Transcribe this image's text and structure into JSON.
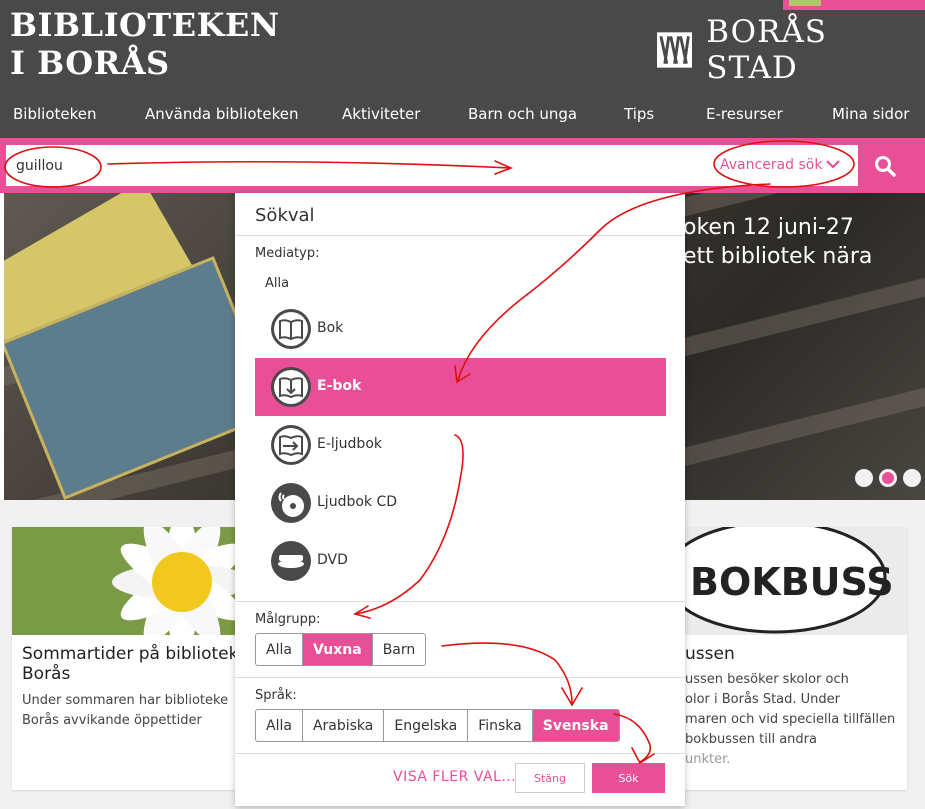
{
  "header": {
    "logo_line1": "BIBLIOTEKEN",
    "logo_line2": "I BORÅS",
    "city_name": "BORÅS STAD",
    "nav": [
      "Biblioteken",
      "Använda biblioteken",
      "Aktiviteter",
      "Barn och unga",
      "Tips",
      "E-resurser",
      "Mina sidor"
    ]
  },
  "search": {
    "value": "guillou",
    "advanced_label": "Avancerad sök",
    "button_icon": "search-icon"
  },
  "hero": {
    "line1": "oken 12 juni-27",
    "line2": "ett bibliotek nära",
    "slides": 3,
    "active_slide": 2
  },
  "cards": [
    {
      "title_line1": "Sommartider på bibliotek",
      "title_line2": "Borås",
      "text_line1": "Under sommaren har biblioteke",
      "text_line2": "Borås avvikande öppettider"
    },
    {
      "image_text": "BOKBUSS",
      "title": "ussen",
      "text_line1": "ussen besöker skolor och",
      "text_line2": "olor i Borås Stad. Under",
      "text_line3": "maren och vid speciella tillfällen",
      "text_line4": "bokbussen till andra",
      "text_line5": "unkter."
    }
  ],
  "panel": {
    "title": "Sökval",
    "media_label": "Mediatyp:",
    "media_all": "Alla",
    "media": [
      {
        "label": "Bok",
        "icon": "book-icon",
        "selected": false
      },
      {
        "label": "E-bok",
        "icon": "ebook-icon",
        "selected": true
      },
      {
        "label": "E-ljudbok",
        "icon": "eaudiobook-icon",
        "selected": false
      },
      {
        "label": "Ljudbok CD",
        "icon": "cd-icon",
        "selected": false
      },
      {
        "label": "DVD",
        "icon": "dvd-icon",
        "selected": false
      }
    ],
    "target_label": "Målgrupp:",
    "target": [
      "Alla",
      "Vuxna",
      "Barn"
    ],
    "target_selected": "Vuxna",
    "lang_label": "Språk:",
    "languages": [
      "Alla",
      "Arabiska",
      "Engelska",
      "Finska",
      "Svenska"
    ],
    "lang_selected": "Svenska",
    "more_label": "VISA FLER VAL...",
    "close_label": "Stäng",
    "submit_label": "Sök"
  },
  "colors": {
    "accent": "#e94f96",
    "header": "#4a494a",
    "annotation": "#e01010"
  }
}
